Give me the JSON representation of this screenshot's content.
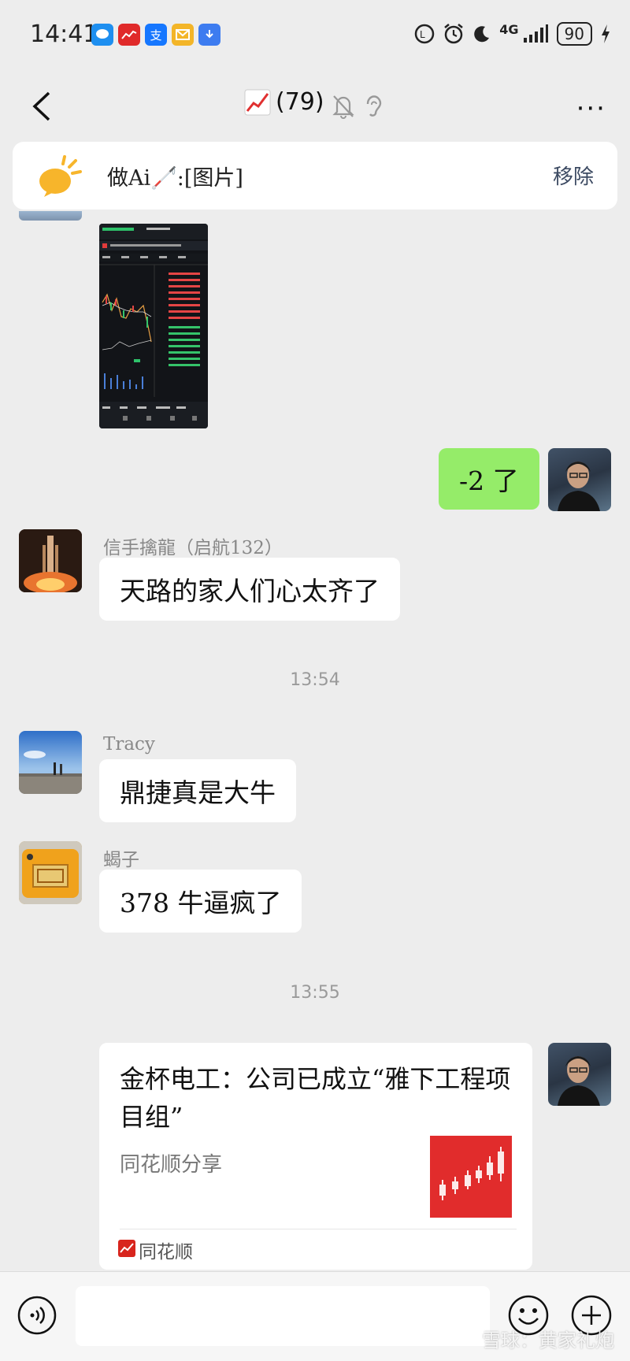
{
  "status_bar": {
    "time": "14:41",
    "network": "4G",
    "battery": "90",
    "apps": [
      {
        "icon": "chat-bubble-icon",
        "color": "#1e8ff0"
      },
      {
        "icon": "stock-app-icon",
        "color": "#e02a2a"
      },
      {
        "icon": "alipay-icon",
        "color": "#1677ff",
        "glyph": "支"
      },
      {
        "icon": "mail-icon",
        "color": "#f3b528"
      },
      {
        "icon": "download-icon",
        "color": "#3d7cf0"
      }
    ]
  },
  "nav": {
    "title_count": "(79)"
  },
  "pinned": {
    "text": "做Ai🦯:[图片]",
    "remove_label": "移除"
  },
  "messages": {
    "m1_text": "-2 了",
    "m2_sender": "信手擒龍（启航132）",
    "m2_text": "天路的家人们心太齐了",
    "ts1": "13:54",
    "m3_sender": "Tracy",
    "m3_text": "鼎捷真是大牛",
    "m4_sender": "蝎子",
    "m4_text": "378 牛逼疯了",
    "ts2": "13:55"
  },
  "card": {
    "title": "金杯电工：公司已成立“雅下工程项目组”",
    "subtitle": "同花顺分享",
    "source": "同花顺"
  },
  "watermark": "雪球：黄家礼炮",
  "colors": {
    "my_bubble": "#95ec69",
    "background": "#ededed",
    "remove_link": "#3c4a62"
  }
}
